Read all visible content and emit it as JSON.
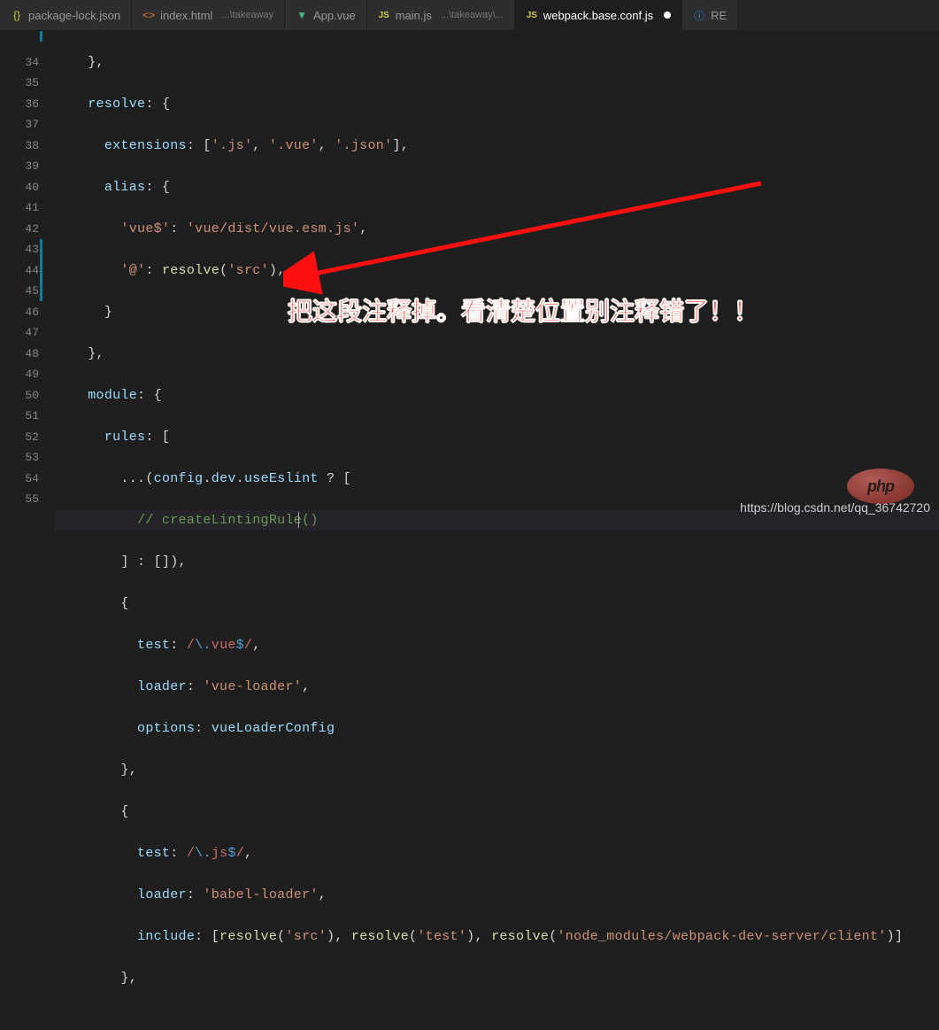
{
  "tabs": [
    {
      "icon": "json",
      "label": "package-lock.json",
      "sub": ""
    },
    {
      "icon": "html",
      "label": "index.html",
      "sub": "...\\takeaway"
    },
    {
      "icon": "vue",
      "label": "App.vue",
      "sub": ""
    },
    {
      "icon": "js",
      "label": "main.js",
      "sub": "...\\takeaway\\..."
    },
    {
      "icon": "js",
      "label": "webpack.base.conf.js",
      "sub": "",
      "active": true,
      "dirty": true
    },
    {
      "icon": "info",
      "label": "RE",
      "sub": ""
    }
  ],
  "lineStart": 33,
  "lineEnd": 55,
  "code": {
    "l34a": "resolve",
    "l34b": ": {",
    "l35a": "extensions",
    "l35b": ": [",
    "l35c": "'.js'",
    "l35d": ", ",
    "l35e": "'.vue'",
    "l35f": ", ",
    "l35g": "'.json'",
    "l35h": "],",
    "l36a": "alias",
    "l36b": ": {",
    "l37a": "'vue$'",
    "l37b": ": ",
    "l37c": "'vue/dist/vue.esm.js'",
    "l37d": ",",
    "l38a": "'@'",
    "l38b": ": ",
    "l38c": "resolve",
    "l38d": "(",
    "l38e": "'src'",
    "l38f": "),",
    "l39a": "}",
    "l40a": "},",
    "l41a": "module",
    "l41b": ": {",
    "l42a": "rules",
    "l42b": ": [",
    "l43a": "...(",
    "l43b": "config",
    "l43c": ".",
    "l43d": "dev",
    "l43e": ".",
    "l43f": "useEslint",
    "l43g": " ? [",
    "l44a": "// createLintingRule()",
    "l45a": "] : []),",
    "l46a": "{",
    "l47a": "test",
    "l47b": ":",
    "l47c": " /",
    "l47d": "\\.",
    "l47e": "vue",
    "l47f": "$",
    "l47g": "/",
    "l47h": ",",
    "l48a": "loader",
    "l48b": ": ",
    "l48c": "'vue-loader'",
    "l48d": ",",
    "l49a": "options",
    "l49b": ": ",
    "l49c": "vueLoaderConfig",
    "l50a": "},",
    "l51a": "{",
    "l52a": "test",
    "l52b": ":",
    "l52c": " /",
    "l52d": "\\.",
    "l52e": "js",
    "l52f": "$",
    "l52g": "/",
    "l52h": ",",
    "l53a": "loader",
    "l53b": ": ",
    "l53c": "'babel-loader'",
    "l53d": ",",
    "l54a": "include",
    "l54b": ": [",
    "l54c": "resolve",
    "l54d": "(",
    "l54e": "'src'",
    "l54f": "), ",
    "l54g": "resolve",
    "l54h": "(",
    "l54i": "'test'",
    "l54j": "), ",
    "l54k": "resolve",
    "l54l": "(",
    "l54m": "'node_modules/webpack-dev-server/client'",
    "l54n": ")]",
    "l55a": "},"
  },
  "annotation": "把这段注释掉。看清楚位置别注释错了！！",
  "watermark": "https://blog.csdn.net/qq_36742720",
  "logo": "php"
}
